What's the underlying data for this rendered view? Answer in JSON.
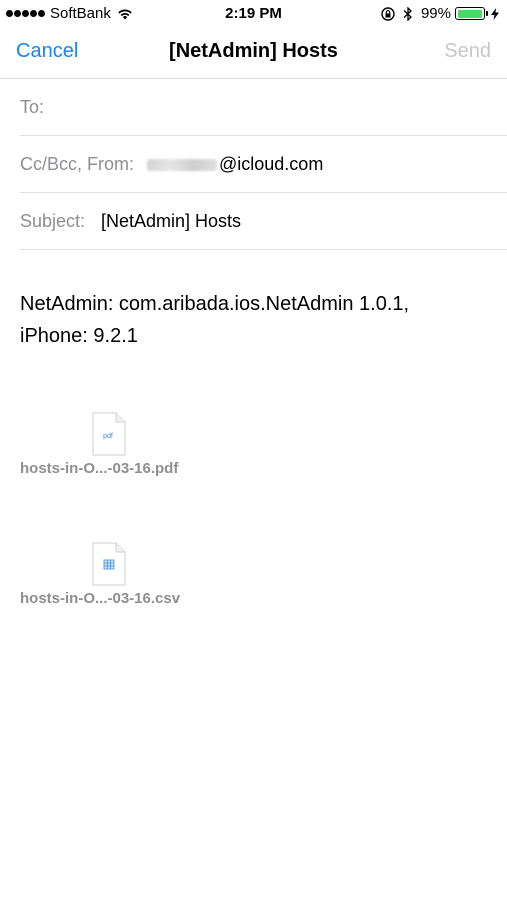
{
  "status_bar": {
    "carrier": "SoftBank",
    "time": "2:19 PM",
    "battery_percent": "99%",
    "battery_level": 0.99,
    "signal_bars": 5
  },
  "nav": {
    "cancel_label": "Cancel",
    "title": "[NetAdmin] Hosts",
    "send_label": "Send"
  },
  "fields": {
    "to_label": "To:",
    "cc_label": "Cc/Bcc, From:",
    "from_domain": "@icloud.com",
    "subject_label": "Subject:",
    "subject_value": "[NetAdmin] Hosts"
  },
  "body": {
    "line1": "NetAdmin: com.aribada.ios.NetAdmin 1.0.1,",
    "line2": "iPhone: 9.2.1"
  },
  "attachments": [
    {
      "name": "hosts-in-O...-03-16.pdf",
      "icon": "pdf-file-icon",
      "badge": "pdf"
    },
    {
      "name": "hosts-in-O...-03-16.csv",
      "icon": "csv-file-icon"
    }
  ],
  "colors": {
    "accent": "#1a82fb",
    "disabled": "#c7c7cc",
    "label_gray": "#8e8e93",
    "battery": "#4cd964"
  }
}
